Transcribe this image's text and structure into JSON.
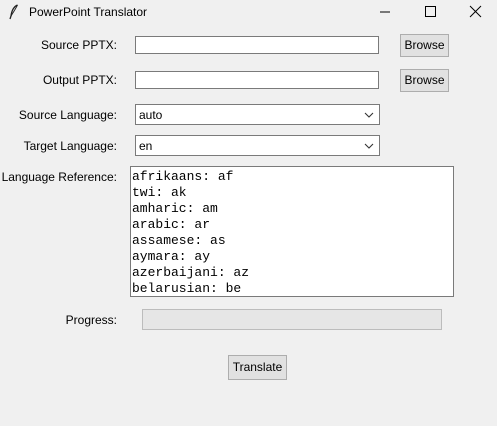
{
  "window": {
    "title": "PowerPoint Translator",
    "icon": "feather-icon",
    "controls": [
      "minimize-icon",
      "maximize-icon",
      "close-icon"
    ]
  },
  "form": {
    "source_pptx": {
      "label": "Source PPTX:",
      "value": "",
      "browse_label": "Browse"
    },
    "output_pptx": {
      "label": "Output PPTX:",
      "value": "",
      "browse_label": "Browse"
    },
    "source_language": {
      "label": "Source Language:",
      "value": "auto"
    },
    "target_language": {
      "label": "Target Language:",
      "value": "en"
    },
    "language_reference": {
      "label": "Language Reference:",
      "items": [
        "afrikaans: af",
        "twi: ak",
        "amharic: am",
        "arabic: ar",
        "assamese: as",
        "aymara: ay",
        "azerbaijani: az",
        "belarusian: be"
      ]
    },
    "progress": {
      "label": "Progress:",
      "fraction": 0
    },
    "translate_label": "Translate"
  }
}
